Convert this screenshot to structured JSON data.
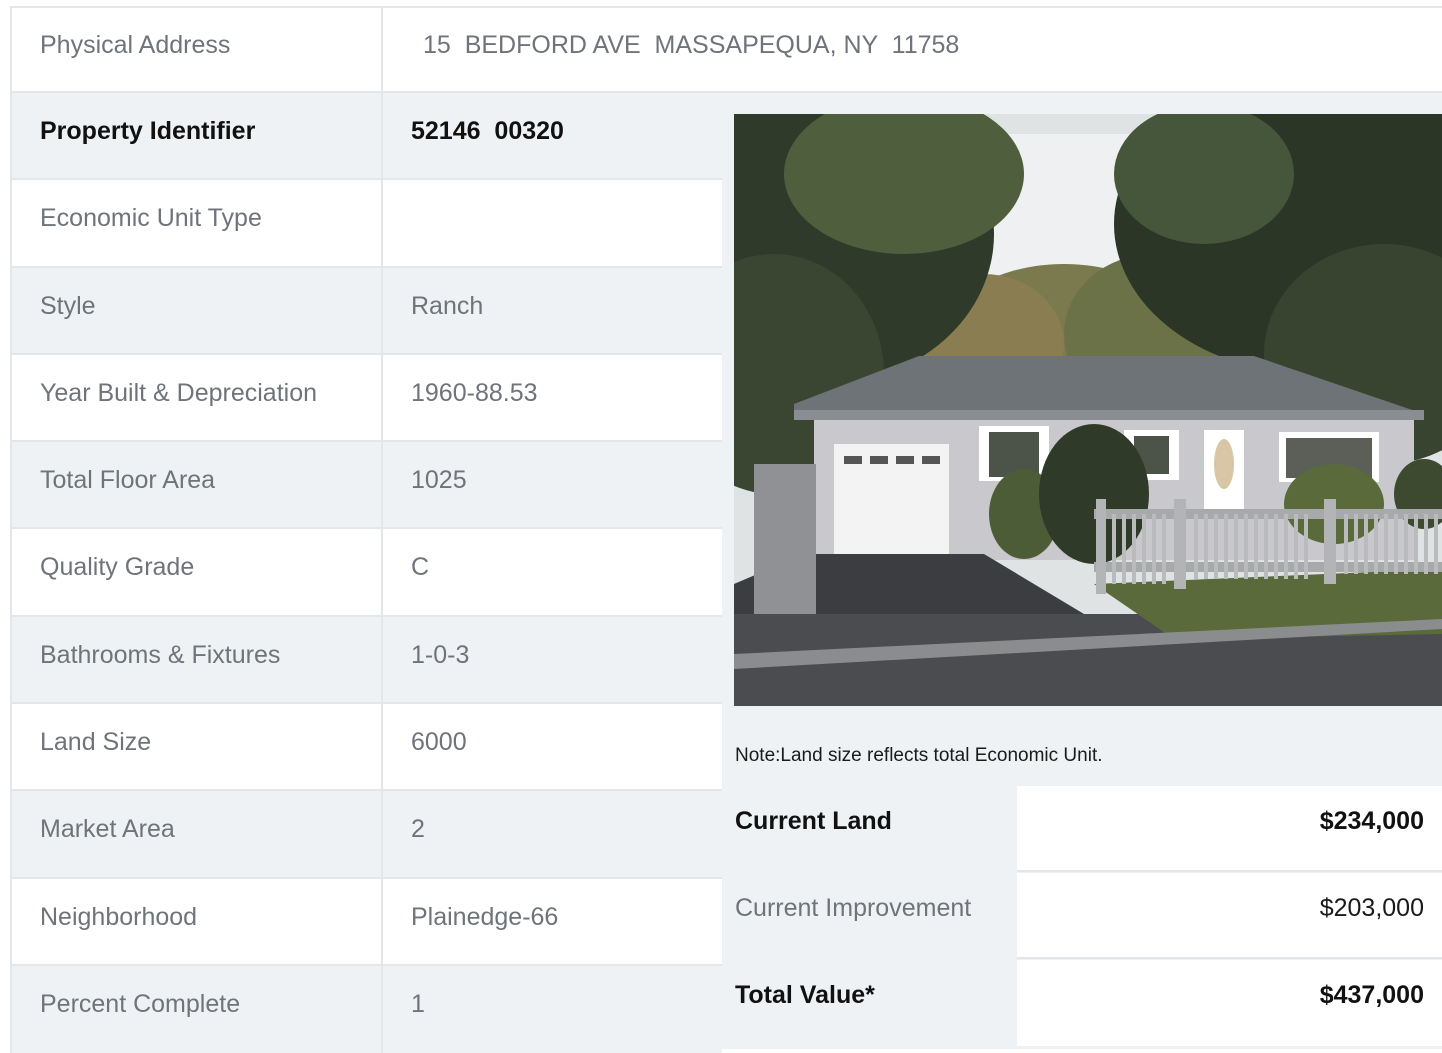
{
  "address": {
    "label": "Physical Address",
    "value": "15  BEDFORD AVE  MASSAPEQUA, NY  11758"
  },
  "details": [
    {
      "label": "Property Identifier",
      "value": "52146  00320",
      "bold": true
    },
    {
      "label": "Economic Unit Type",
      "value": ""
    },
    {
      "label": "Style",
      "value": "Ranch"
    },
    {
      "label": "Year Built & Depreciation",
      "value": "1960-88.53"
    },
    {
      "label": "Total Floor Area",
      "value": "1025"
    },
    {
      "label": "Quality Grade",
      "value": "C"
    },
    {
      "label": "Bathrooms & Fixtures",
      "value": "1-0-3"
    },
    {
      "label": "Land Size",
      "value": "6000"
    },
    {
      "label": "Market Area",
      "value": "2"
    },
    {
      "label": "Neighborhood",
      "value": "Plainedge-66"
    },
    {
      "label": "Percent Complete",
      "value": "1"
    }
  ],
  "note": "Note:Land size reflects total Economic Unit.",
  "valuation": [
    {
      "label": "Current Land",
      "value": "$234,000",
      "bold": true
    },
    {
      "label": "Current Improvement",
      "value": "$203,000",
      "bold": false
    },
    {
      "label": "Total Value*",
      "value": "$437,000",
      "bold": true
    }
  ],
  "photo": {
    "subject": "house-photo",
    "colors": {
      "sky": "#e9ecee",
      "foliage_dark": "#2f3a2a",
      "foliage_mid": "#4f5e3c",
      "roof": "#6e7378",
      "siding": "#c9c9cd",
      "driveway": "#3b3d40",
      "fence": "#9a9c9e"
    }
  }
}
